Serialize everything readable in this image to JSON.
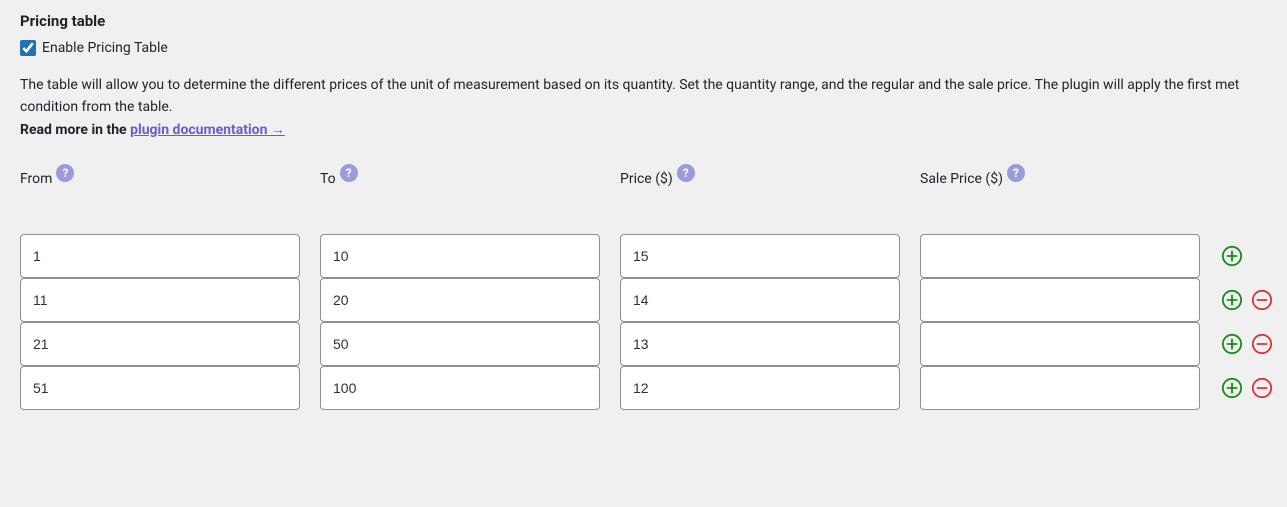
{
  "section": {
    "title": "Pricing table",
    "enable_label": "Enable Pricing Table",
    "enable_checked": true,
    "description": "The table will allow you to determine the different prices of the unit of measurement based on its quantity. Set the quantity range, and the regular and the sale price. The plugin will apply the first met condition from the table.",
    "read_more_prefix": "Read more in the ",
    "read_more_link": "plugin documentation →"
  },
  "headers": {
    "from": "From",
    "to": "To",
    "price": "Price ($)",
    "sale_price": "Sale Price ($)"
  },
  "help_glyph": "?",
  "rows": [
    {
      "from": "1",
      "to": "10",
      "price": "15",
      "sale_price": "",
      "add": true,
      "remove": false
    },
    {
      "from": "11",
      "to": "20",
      "price": "14",
      "sale_price": "",
      "add": true,
      "remove": true
    },
    {
      "from": "21",
      "to": "50",
      "price": "13",
      "sale_price": "",
      "add": true,
      "remove": true
    },
    {
      "from": "51",
      "to": "100",
      "price": "12",
      "sale_price": "",
      "add": true,
      "remove": true
    }
  ]
}
